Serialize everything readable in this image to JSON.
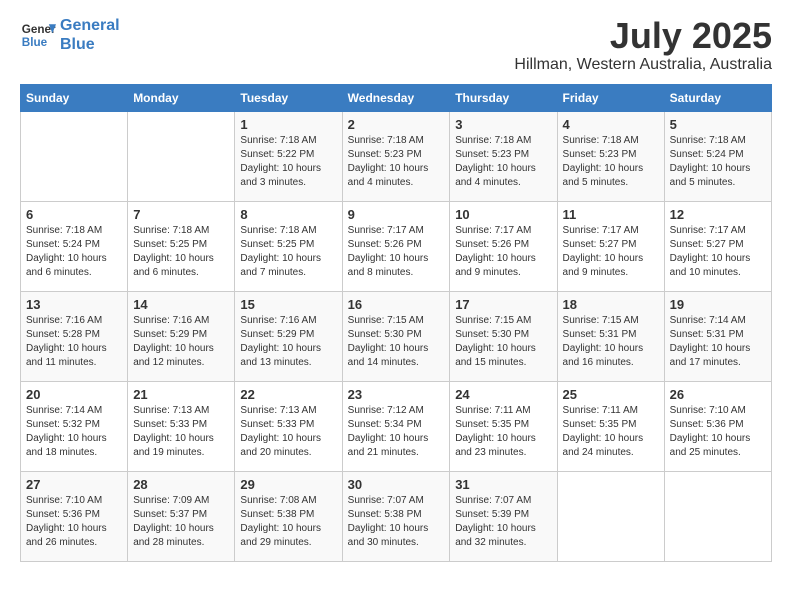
{
  "header": {
    "logo_line1": "General",
    "logo_line2": "Blue",
    "title": "July 2025",
    "subtitle": "Hillman, Western Australia, Australia"
  },
  "calendar": {
    "days_of_week": [
      "Sunday",
      "Monday",
      "Tuesday",
      "Wednesday",
      "Thursday",
      "Friday",
      "Saturday"
    ],
    "weeks": [
      [
        {
          "day": "",
          "info": ""
        },
        {
          "day": "",
          "info": ""
        },
        {
          "day": "1",
          "info": "Sunrise: 7:18 AM\nSunset: 5:22 PM\nDaylight: 10 hours\nand 3 minutes."
        },
        {
          "day": "2",
          "info": "Sunrise: 7:18 AM\nSunset: 5:23 PM\nDaylight: 10 hours\nand 4 minutes."
        },
        {
          "day": "3",
          "info": "Sunrise: 7:18 AM\nSunset: 5:23 PM\nDaylight: 10 hours\nand 4 minutes."
        },
        {
          "day": "4",
          "info": "Sunrise: 7:18 AM\nSunset: 5:23 PM\nDaylight: 10 hours\nand 5 minutes."
        },
        {
          "day": "5",
          "info": "Sunrise: 7:18 AM\nSunset: 5:24 PM\nDaylight: 10 hours\nand 5 minutes."
        }
      ],
      [
        {
          "day": "6",
          "info": "Sunrise: 7:18 AM\nSunset: 5:24 PM\nDaylight: 10 hours\nand 6 minutes."
        },
        {
          "day": "7",
          "info": "Sunrise: 7:18 AM\nSunset: 5:25 PM\nDaylight: 10 hours\nand 6 minutes."
        },
        {
          "day": "8",
          "info": "Sunrise: 7:18 AM\nSunset: 5:25 PM\nDaylight: 10 hours\nand 7 minutes."
        },
        {
          "day": "9",
          "info": "Sunrise: 7:17 AM\nSunset: 5:26 PM\nDaylight: 10 hours\nand 8 minutes."
        },
        {
          "day": "10",
          "info": "Sunrise: 7:17 AM\nSunset: 5:26 PM\nDaylight: 10 hours\nand 9 minutes."
        },
        {
          "day": "11",
          "info": "Sunrise: 7:17 AM\nSunset: 5:27 PM\nDaylight: 10 hours\nand 9 minutes."
        },
        {
          "day": "12",
          "info": "Sunrise: 7:17 AM\nSunset: 5:27 PM\nDaylight: 10 hours\nand 10 minutes."
        }
      ],
      [
        {
          "day": "13",
          "info": "Sunrise: 7:16 AM\nSunset: 5:28 PM\nDaylight: 10 hours\nand 11 minutes."
        },
        {
          "day": "14",
          "info": "Sunrise: 7:16 AM\nSunset: 5:29 PM\nDaylight: 10 hours\nand 12 minutes."
        },
        {
          "day": "15",
          "info": "Sunrise: 7:16 AM\nSunset: 5:29 PM\nDaylight: 10 hours\nand 13 minutes."
        },
        {
          "day": "16",
          "info": "Sunrise: 7:15 AM\nSunset: 5:30 PM\nDaylight: 10 hours\nand 14 minutes."
        },
        {
          "day": "17",
          "info": "Sunrise: 7:15 AM\nSunset: 5:30 PM\nDaylight: 10 hours\nand 15 minutes."
        },
        {
          "day": "18",
          "info": "Sunrise: 7:15 AM\nSunset: 5:31 PM\nDaylight: 10 hours\nand 16 minutes."
        },
        {
          "day": "19",
          "info": "Sunrise: 7:14 AM\nSunset: 5:31 PM\nDaylight: 10 hours\nand 17 minutes."
        }
      ],
      [
        {
          "day": "20",
          "info": "Sunrise: 7:14 AM\nSunset: 5:32 PM\nDaylight: 10 hours\nand 18 minutes."
        },
        {
          "day": "21",
          "info": "Sunrise: 7:13 AM\nSunset: 5:33 PM\nDaylight: 10 hours\nand 19 minutes."
        },
        {
          "day": "22",
          "info": "Sunrise: 7:13 AM\nSunset: 5:33 PM\nDaylight: 10 hours\nand 20 minutes."
        },
        {
          "day": "23",
          "info": "Sunrise: 7:12 AM\nSunset: 5:34 PM\nDaylight: 10 hours\nand 21 minutes."
        },
        {
          "day": "24",
          "info": "Sunrise: 7:11 AM\nSunset: 5:35 PM\nDaylight: 10 hours\nand 23 minutes."
        },
        {
          "day": "25",
          "info": "Sunrise: 7:11 AM\nSunset: 5:35 PM\nDaylight: 10 hours\nand 24 minutes."
        },
        {
          "day": "26",
          "info": "Sunrise: 7:10 AM\nSunset: 5:36 PM\nDaylight: 10 hours\nand 25 minutes."
        }
      ],
      [
        {
          "day": "27",
          "info": "Sunrise: 7:10 AM\nSunset: 5:36 PM\nDaylight: 10 hours\nand 26 minutes."
        },
        {
          "day": "28",
          "info": "Sunrise: 7:09 AM\nSunset: 5:37 PM\nDaylight: 10 hours\nand 28 minutes."
        },
        {
          "day": "29",
          "info": "Sunrise: 7:08 AM\nSunset: 5:38 PM\nDaylight: 10 hours\nand 29 minutes."
        },
        {
          "day": "30",
          "info": "Sunrise: 7:07 AM\nSunset: 5:38 PM\nDaylight: 10 hours\nand 30 minutes."
        },
        {
          "day": "31",
          "info": "Sunrise: 7:07 AM\nSunset: 5:39 PM\nDaylight: 10 hours\nand 32 minutes."
        },
        {
          "day": "",
          "info": ""
        },
        {
          "day": "",
          "info": ""
        }
      ]
    ]
  }
}
